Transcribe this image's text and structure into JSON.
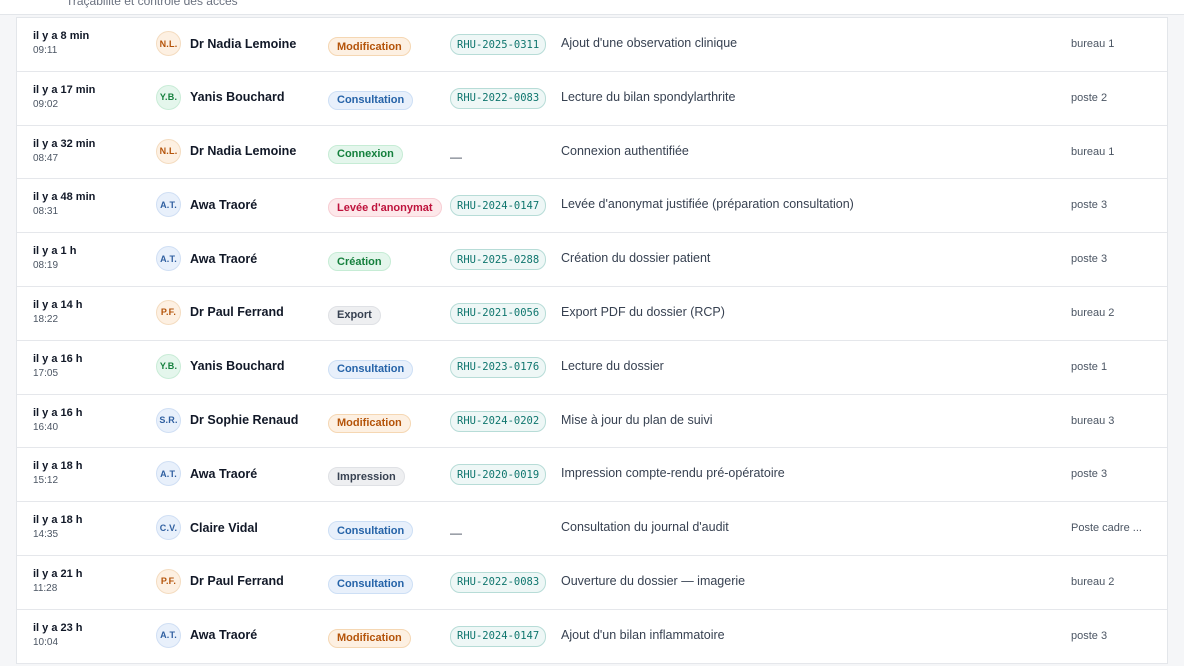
{
  "header": {
    "subtitle": "Traçabilité et contrôle des accès"
  },
  "colors": {
    "modification": {
      "bg": "#fdf0e2",
      "fg": "#b45309",
      "border": "#f5d7b3"
    },
    "consultation": {
      "bg": "#e8f0fb",
      "fg": "#2563a8",
      "border": "#cddff5"
    },
    "connexion": {
      "bg": "#e4f6ec",
      "fg": "#15803d",
      "border": "#c6ecd5"
    },
    "levee": {
      "bg": "#fde8ea",
      "fg": "#be123c",
      "border": "#f7cdd3"
    },
    "creation": {
      "bg": "#e4f6ec",
      "fg": "#15803d",
      "border": "#c6ecd5"
    },
    "export": {
      "bg": "#eeeff1",
      "fg": "#374151",
      "border": "#dfe1e5"
    },
    "impression": {
      "bg": "#eeeff1",
      "fg": "#374151",
      "border": "#dfe1e5"
    }
  },
  "avatar_colors": {
    "orange": {
      "bg": "#fdf0e2",
      "fg": "#b45309",
      "border": "#f4dcc0"
    },
    "green": {
      "bg": "#e4f6ec",
      "fg": "#15803d",
      "border": "#c9ecd7"
    },
    "blue": {
      "bg": "#e8f0fb",
      "fg": "#2f5fa0",
      "border": "#d0dff4"
    }
  },
  "rows": [
    {
      "rel": "il y a 8 min",
      "abs": "09:11",
      "initials": "N.L.",
      "avatar": "orange",
      "user": "Dr Nadia Lemoine",
      "type": "Modification",
      "kind": "modification",
      "patient": "RHU-2025-0311",
      "action": "Ajout d'une observation clinique",
      "station": "bureau 1"
    },
    {
      "rel": "il y a 17 min",
      "abs": "09:02",
      "initials": "Y.B.",
      "avatar": "green",
      "user": "Yanis Bouchard",
      "type": "Consultation",
      "kind": "consultation",
      "patient": "RHU-2022-0083",
      "action": "Lecture du bilan spondylarthrite",
      "station": "poste 2"
    },
    {
      "rel": "il y a 32 min",
      "abs": "08:47",
      "initials": "N.L.",
      "avatar": "orange",
      "user": "Dr Nadia Lemoine",
      "type": "Connexion",
      "kind": "connexion",
      "patient": "—",
      "action": "Connexion authentifiée",
      "station": "bureau 1"
    },
    {
      "rel": "il y a 48 min",
      "abs": "08:31",
      "initials": "A.T.",
      "avatar": "blue",
      "user": "Awa Traoré",
      "type": "Levée d'anonymat",
      "kind": "levee",
      "patient": "RHU-2024-0147",
      "action": "Levée d'anonymat justifiée (préparation consultation)",
      "station": "poste 3"
    },
    {
      "rel": "il y a 1 h",
      "abs": "08:19",
      "initials": "A.T.",
      "avatar": "blue",
      "user": "Awa Traoré",
      "type": "Création",
      "kind": "creation",
      "patient": "RHU-2025-0288",
      "action": "Création du dossier patient",
      "station": "poste 3"
    },
    {
      "rel": "il y a 14 h",
      "abs": "18:22",
      "initials": "P.F.",
      "avatar": "orange",
      "user": "Dr Paul Ferrand",
      "type": "Export",
      "kind": "export",
      "patient": "RHU-2021-0056",
      "action": "Export PDF du dossier (RCP)",
      "station": "bureau 2"
    },
    {
      "rel": "il y a 16 h",
      "abs": "17:05",
      "initials": "Y.B.",
      "avatar": "green",
      "user": "Yanis Bouchard",
      "type": "Consultation",
      "kind": "consultation",
      "patient": "RHU-2023-0176",
      "action": "Lecture du dossier",
      "station": "poste 1"
    },
    {
      "rel": "il y a 16 h",
      "abs": "16:40",
      "initials": "S.R.",
      "avatar": "blue",
      "user": "Dr Sophie Renaud",
      "type": "Modification",
      "kind": "modification",
      "patient": "RHU-2024-0202",
      "action": "Mise à jour du plan de suivi",
      "station": "bureau 3"
    },
    {
      "rel": "il y a 18 h",
      "abs": "15:12",
      "initials": "A.T.",
      "avatar": "blue",
      "user": "Awa Traoré",
      "type": "Impression",
      "kind": "impression",
      "patient": "RHU-2020-0019",
      "action": "Impression compte-rendu pré-opératoire",
      "station": "poste 3"
    },
    {
      "rel": "il y a 18 h",
      "abs": "14:35",
      "initials": "C.V.",
      "avatar": "blue",
      "user": "Claire Vidal",
      "type": "Consultation",
      "kind": "consultation",
      "patient": "—",
      "action": "Consultation du journal d'audit",
      "station": "Poste cadre ..."
    },
    {
      "rel": "il y a 21 h",
      "abs": "11:28",
      "initials": "P.F.",
      "avatar": "orange",
      "user": "Dr Paul Ferrand",
      "type": "Consultation",
      "kind": "consultation",
      "patient": "RHU-2022-0083",
      "action": "Ouverture du dossier — imagerie",
      "station": "bureau 2"
    },
    {
      "rel": "il y a 23 h",
      "abs": "10:04",
      "initials": "A.T.",
      "avatar": "blue",
      "user": "Awa Traoré",
      "type": "Modification",
      "kind": "modification",
      "patient": "RHU-2024-0147",
      "action": "Ajout d'un bilan inflammatoire",
      "station": "poste 3"
    }
  ]
}
